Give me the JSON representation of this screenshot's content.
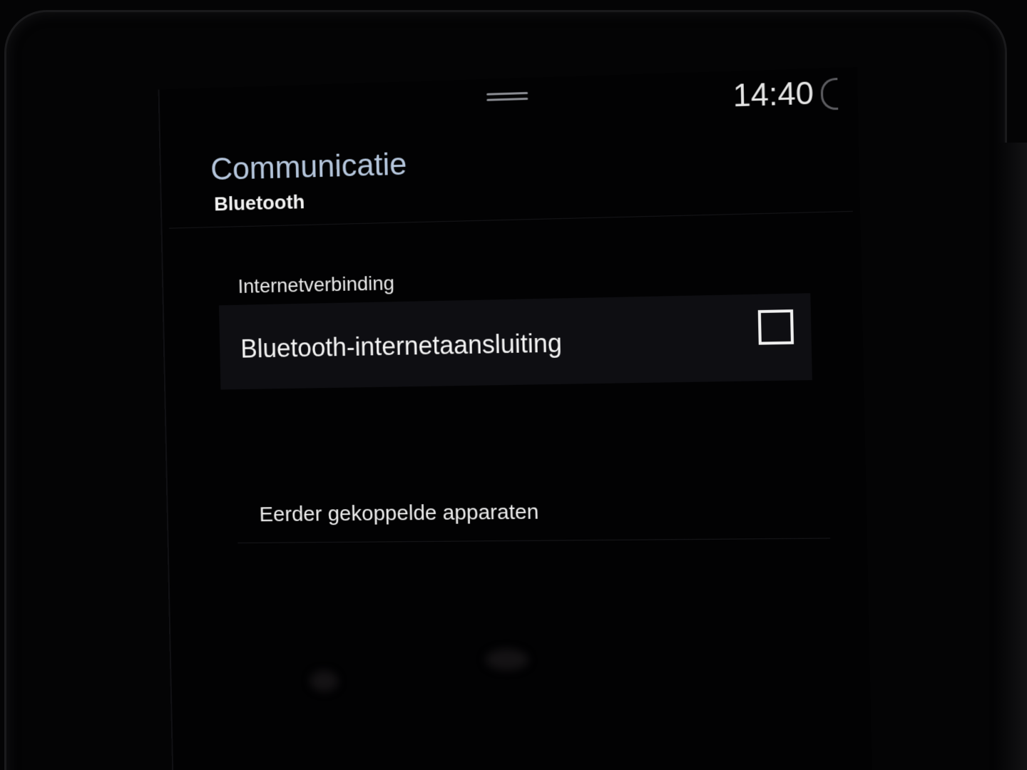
{
  "status_bar": {
    "time": "14:40"
  },
  "header": {
    "title": "Communicatie",
    "subtitle": "Bluetooth"
  },
  "sections": {
    "internet": {
      "label": "Internetverbinding",
      "option_label": "Bluetooth-internetaansluiting",
      "checked": false
    },
    "paired": {
      "label": "Eerder gekoppelde apparaten"
    }
  },
  "colors": {
    "title": "#b5c6dc",
    "background": "#020203",
    "row_background": "#0e0e12",
    "text": "#f4f4f4"
  },
  "icons": {
    "drag_handle": "drag-handle-icon",
    "user": "user-icon",
    "checkbox": "checkbox-unchecked-icon"
  }
}
